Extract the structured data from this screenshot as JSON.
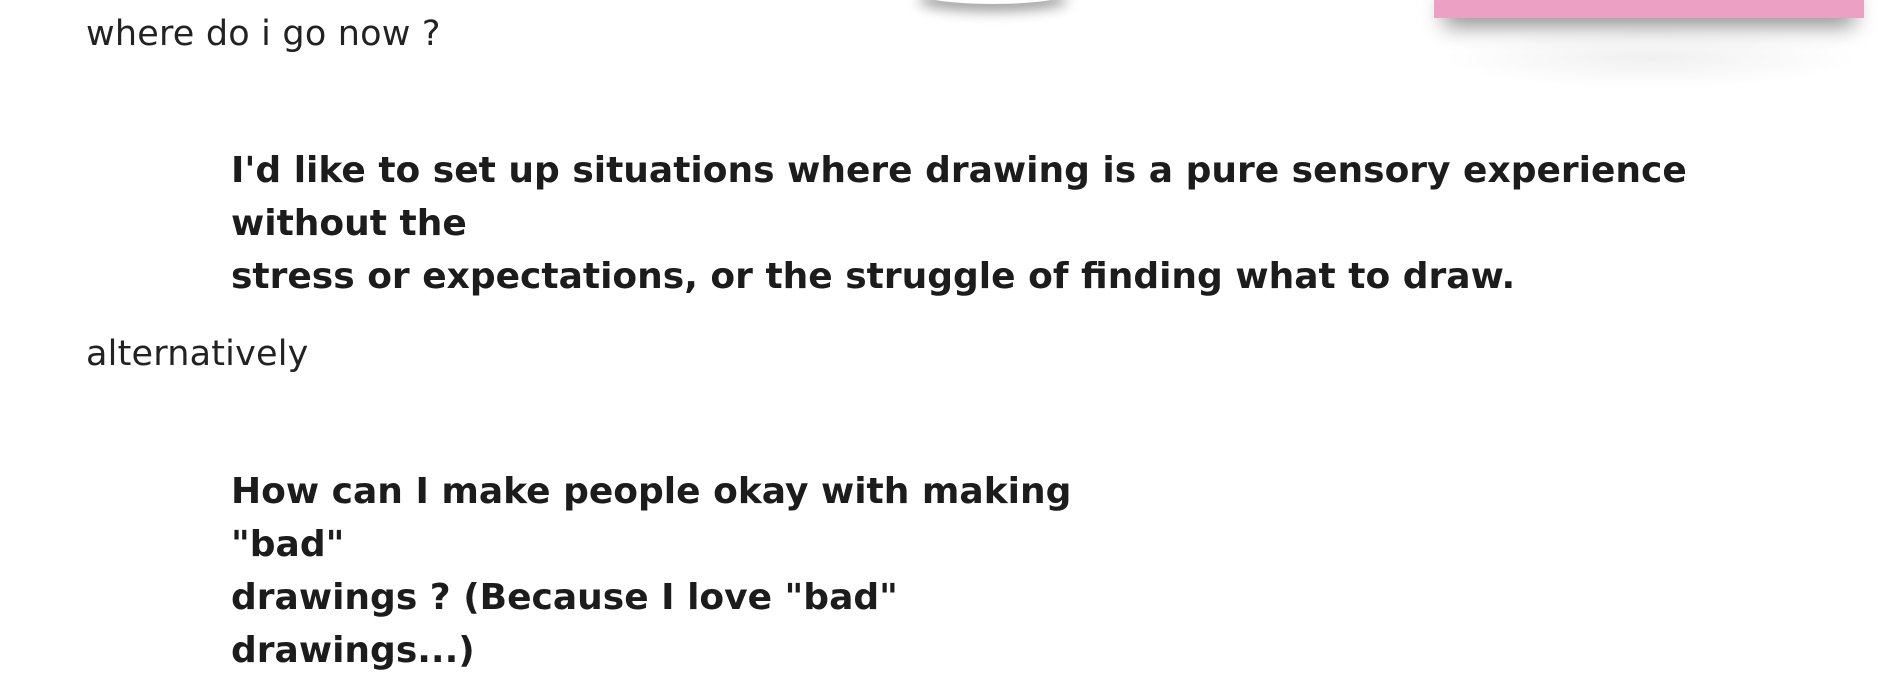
{
  "sections": [
    {
      "lead": "where do i go now ?",
      "quote_line_1": "I'd like to set up situations where drawing is a pure sensory experience without the",
      "quote_line_2": "stress or expectations, or the struggle of finding what to draw."
    },
    {
      "lead": "alternatively",
      "quote_line_1": "How can I make people okay with making \"bad\"",
      "quote_line_2": "drawings ? (Because I love \"bad\" drawings...)"
    }
  ],
  "colors": {
    "sticky_note": "#eba0c4",
    "text": "#1f1f1f",
    "background": "#ffffff"
  }
}
